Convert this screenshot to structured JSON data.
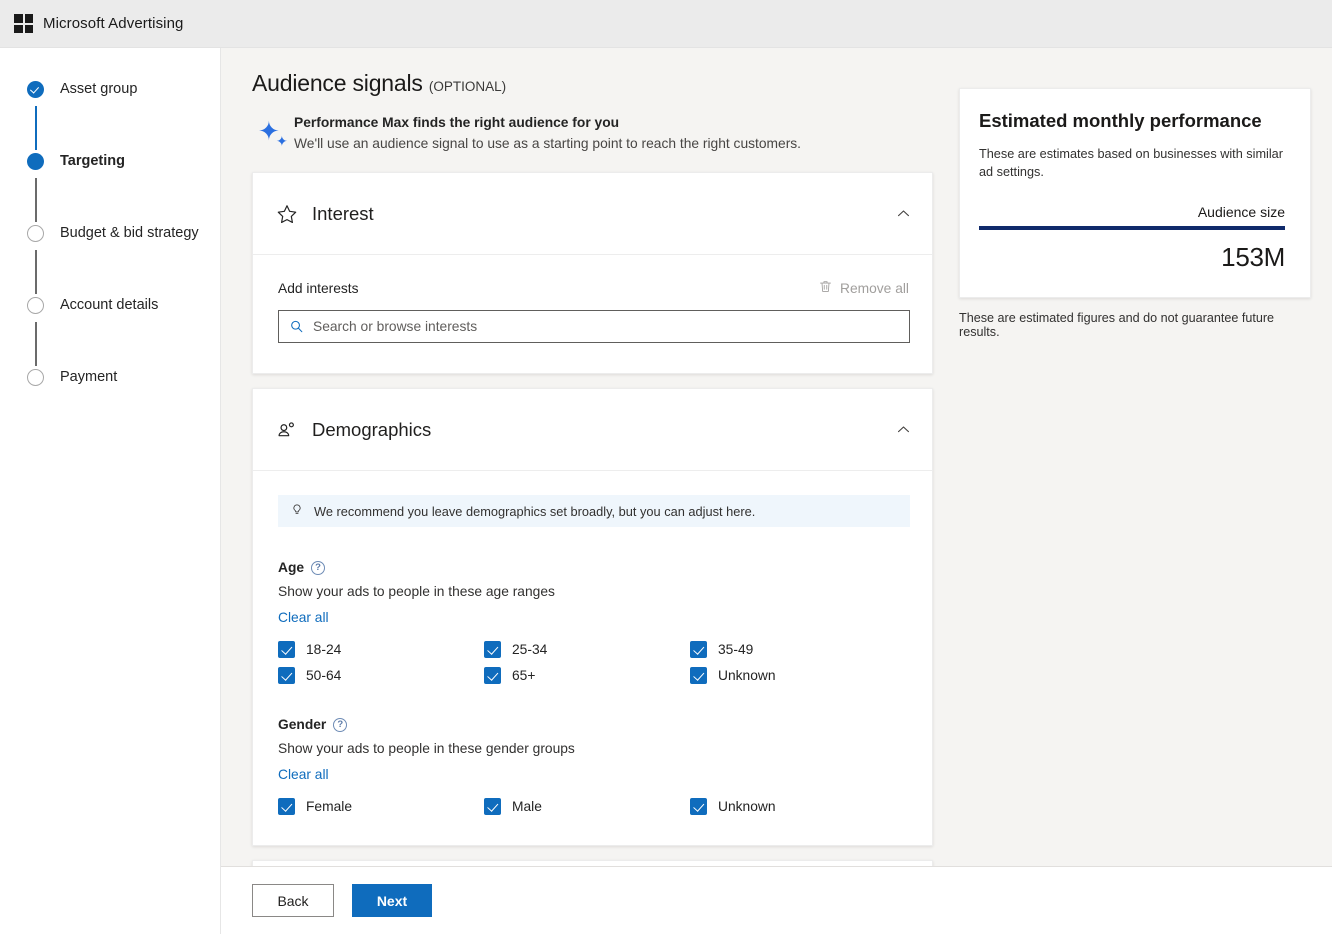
{
  "header": {
    "brand": "Microsoft Advertising",
    "logo_icon": "microsoft-logo-icon"
  },
  "sidebar": {
    "steps": [
      {
        "label": "Asset group",
        "state": "completed"
      },
      {
        "label": "Targeting",
        "state": "current"
      },
      {
        "label": "Budget & bid strategy",
        "state": "todo"
      },
      {
        "label": "Account details",
        "state": "todo"
      },
      {
        "label": "Payment",
        "state": "todo"
      }
    ]
  },
  "page": {
    "title": "Audience signals",
    "title_optional": "(OPTIONAL)",
    "promo": {
      "icon": "sparkle-icon",
      "title": "Performance Max finds the right audience for you",
      "subtitle": "We'll use an audience signal to use as a starting point to reach the right customers."
    }
  },
  "interest_card": {
    "icon": "star-icon",
    "title": "Interest",
    "collapse_icon": "chevron-up-icon",
    "add_label": "Add interests",
    "remove_all_label": "Remove all",
    "remove_all_icon": "trash-icon",
    "search_icon": "search-icon",
    "search_placeholder": "Search or browse interests",
    "search_value": ""
  },
  "demographics_card": {
    "icon": "people-icon",
    "title": "Demographics",
    "collapse_icon": "chevron-up-icon",
    "tip_icon": "lightbulb-icon",
    "tip": "We recommend you leave demographics set broadly, but you can adjust here.",
    "age": {
      "label": "Age",
      "help_icon": "help-circle-icon",
      "description": "Show your ads to people in these age ranges",
      "clear_all": "Clear all",
      "options": [
        {
          "label": "18-24",
          "checked": true
        },
        {
          "label": "25-34",
          "checked": true
        },
        {
          "label": "35-49",
          "checked": true
        },
        {
          "label": "50-64",
          "checked": true
        },
        {
          "label": "65+",
          "checked": true
        },
        {
          "label": "Unknown",
          "checked": true
        }
      ]
    },
    "gender": {
      "label": "Gender",
      "help_icon": "help-circle-icon",
      "description": "Show your ads to people in these gender groups",
      "clear_all": "Clear all",
      "options": [
        {
          "label": "Female",
          "checked": true
        },
        {
          "label": "Male",
          "checked": true
        },
        {
          "label": "Unknown",
          "checked": true
        }
      ]
    }
  },
  "estimate_panel": {
    "title": "Estimated monthly performance",
    "description": "These are estimates based on businesses with similar ad settings.",
    "metric_label": "Audience size",
    "metric_value": "153M",
    "footnote": "These are estimated figures and do not guarantee future results.",
    "bar_color": "#102a6b"
  },
  "footer": {
    "back_label": "Back",
    "next_label": "Next"
  },
  "colors": {
    "accent": "#0f6cbd",
    "sparkle": "#2b6fe0",
    "banner_bg": "#eff6fc"
  }
}
